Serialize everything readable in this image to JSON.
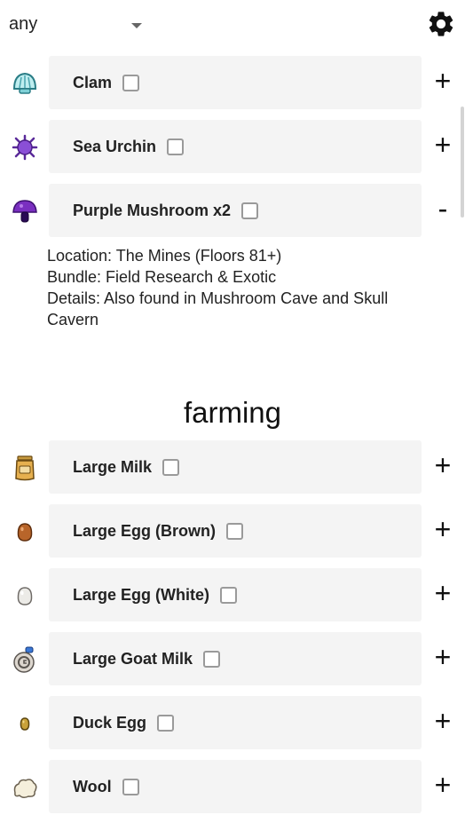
{
  "filter": {
    "value": "any"
  },
  "settings_icon": "gear-icon",
  "items_top": [
    {
      "label": "Clam",
      "toggle": "+",
      "icon": "clam-icon"
    },
    {
      "label": "Sea Urchin",
      "toggle": "+",
      "icon": "sea-urchin-icon"
    },
    {
      "label": "Purple Mushroom x2",
      "toggle": "-",
      "icon": "purple-mushroom-icon"
    }
  ],
  "expanded_details": {
    "location": "Location: The Mines (Floors 81+)",
    "bundle": "Bundle: Field Research & Exotic",
    "details": "Details: Also found in Mushroom Cave and Skull Cavern"
  },
  "section": {
    "title": "farming"
  },
  "items_farming": [
    {
      "label": "Large Milk",
      "toggle": "+",
      "icon": "large-milk-icon"
    },
    {
      "label": "Large Egg (Brown)",
      "toggle": "+",
      "icon": "brown-egg-icon"
    },
    {
      "label": "Large Egg (White)",
      "toggle": "+",
      "icon": "white-egg-icon"
    },
    {
      "label": "Large Goat Milk",
      "toggle": "+",
      "icon": "goat-milk-icon"
    },
    {
      "label": "Duck Egg",
      "toggle": "+",
      "icon": "duck-egg-icon"
    },
    {
      "label": "Wool",
      "toggle": "+",
      "icon": "wool-icon"
    }
  ]
}
